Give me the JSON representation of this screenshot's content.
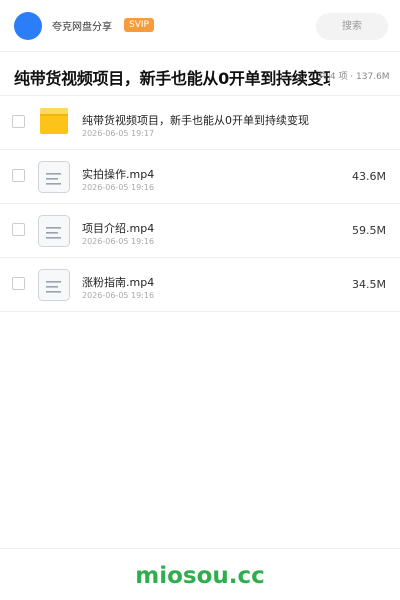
{
  "header": {
    "user_name": "夸克网盘分享",
    "badge": "SVIP",
    "search_placeholder": "搜索"
  },
  "title_row": {
    "title": "纯带货视频项目，新手也能从0开单到持续变现",
    "summary": "共 4 项 · 137.6M"
  },
  "files": [
    {
      "type": "folder",
      "name": "纯带货视频项目，新手也能从0开单到持续变现",
      "date": "2026-06-05 19:17",
      "size": ""
    },
    {
      "type": "file",
      "name": "实拍操作.mp4",
      "date": "2026-06-05 19:16",
      "size": "43.6M"
    },
    {
      "type": "file",
      "name": "项目介绍.mp4",
      "date": "2026-06-05 19:16",
      "size": "59.5M"
    },
    {
      "type": "file",
      "name": "涨粉指南.mp4",
      "date": "2026-06-05 19:16",
      "size": "34.5M"
    }
  ],
  "footer": {
    "watermark": "miosou.cc"
  },
  "colors": {
    "avatar": "#2b7ef7",
    "badge": "#f79c3c",
    "folder": "#fcc419",
    "watermark": "#2fae4e"
  }
}
